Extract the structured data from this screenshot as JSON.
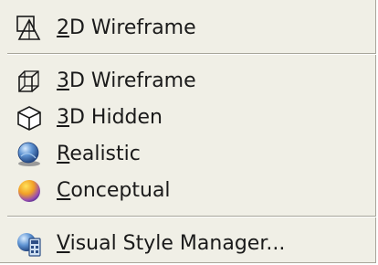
{
  "menu": {
    "items": [
      {
        "mnemonic": "2",
        "rest": "D Wireframe",
        "icon": "2d-wireframe-icon"
      },
      {
        "mnemonic": "3",
        "rest": "D Wireframe",
        "icon": "3d-wireframe-icon"
      },
      {
        "mnemonic": "3",
        "rest": "D Hidden",
        "icon": "3d-hidden-icon"
      },
      {
        "mnemonic": "R",
        "rest": "ealistic",
        "icon": "realistic-icon"
      },
      {
        "mnemonic": "C",
        "rest": "onceptual",
        "icon": "conceptual-icon"
      },
      {
        "mnemonic": "V",
        "rest": "isual Style Manager...",
        "icon": "visual-style-manager-icon"
      }
    ]
  }
}
